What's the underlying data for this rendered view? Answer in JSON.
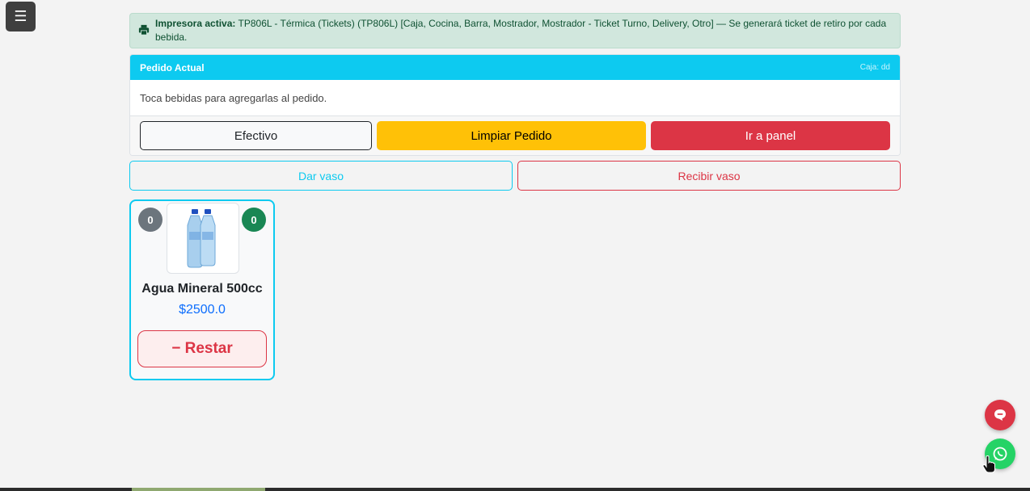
{
  "menu": {
    "icon": "☰"
  },
  "alert": {
    "label": "Impresora activa:",
    "text": " TP806L - Térmica (Tickets) (TP806L) [Caja, Cocina, Barra, Mostrador, Mostrador - Ticket Turno, Delivery, Otro] — Se generará ticket de retiro por cada bebida."
  },
  "order": {
    "title": "Pedido Actual",
    "caja": "Caja: dd",
    "hint": "Toca bebidas para agregarlas al pedido.",
    "actions": {
      "efectivo": "Efectivo",
      "limpiar": "Limpiar Pedido",
      "panel": "Ir a panel"
    }
  },
  "vaso": {
    "dar": "Dar vaso",
    "recibir": "Recibir vaso"
  },
  "products": [
    {
      "name": "Agua Mineral 500cc",
      "price": "$2500.0",
      "badge_left": "0",
      "badge_right": "0",
      "restar_label": "− Restar"
    }
  ],
  "colors": {
    "accent": "#0dcaf0",
    "danger": "#dc3545",
    "warning": "#ffc107",
    "success": "#198754",
    "whatsapp": "#25d366"
  }
}
